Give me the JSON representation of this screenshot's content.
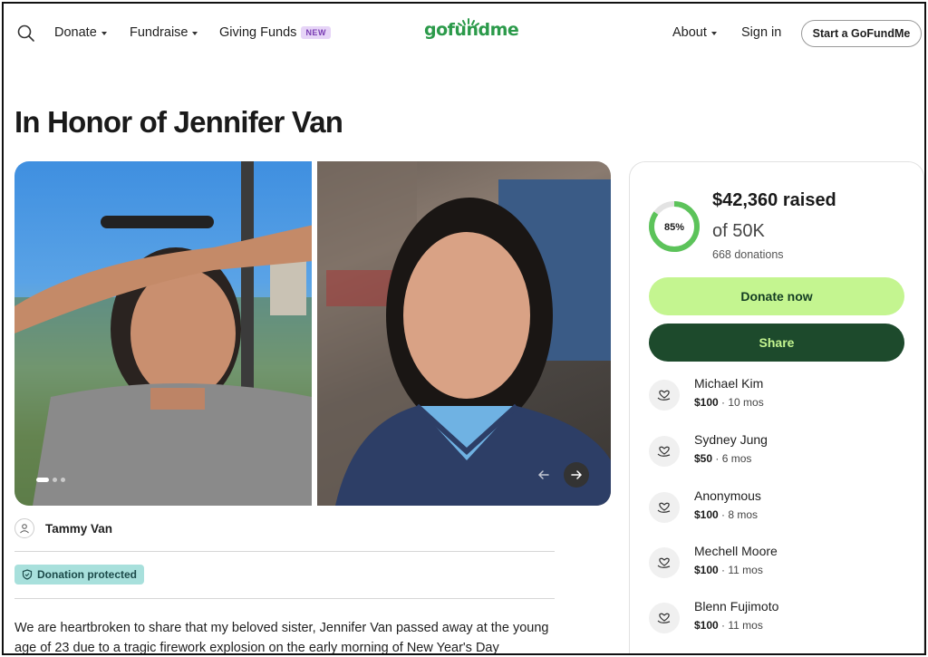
{
  "header": {
    "nav": [
      {
        "label": "Donate",
        "has_caret": true
      },
      {
        "label": "Fundraise",
        "has_caret": true
      },
      {
        "label": "Giving Funds",
        "badge": "NEW"
      }
    ],
    "logo_text": "gofundme",
    "right_nav": [
      {
        "label": "About",
        "has_caret": true
      },
      {
        "label": "Sign in"
      }
    ],
    "start_button": "Start a GoFundMe",
    "icons": {
      "search": "search-icon"
    }
  },
  "page": {
    "title": "In Honor of Jennifer Van",
    "organizer": "Tammy Van",
    "protected_label": "Donation protected",
    "story": "We are heartbroken to share that my beloved sister, Jennifer Van passed away at the young age of 23 due to a tragic firework explosion on the early morning of New Year's Day"
  },
  "gallery": {
    "photo_count": 2,
    "active_index": 0,
    "prev_icon": "arrow-left-icon",
    "next_icon": "arrow-right-icon"
  },
  "donation": {
    "percent_label": "85%",
    "percent": 0.85,
    "raised": "$42,360 raised",
    "goal": "of 50K",
    "donations_count": "668 donations",
    "donate_button": "Donate now",
    "share_button": "Share"
  },
  "donors": [
    {
      "name": "Michael Kim",
      "amount": "$100",
      "when": " · 10 mos"
    },
    {
      "name": "Sydney Jung",
      "amount": "$50",
      "when": " · 6 mos"
    },
    {
      "name": "Anonymous",
      "amount": "$100",
      "when": " · 8 mos"
    },
    {
      "name": "Mechell Moore",
      "amount": "$100",
      "when": " · 11 mos"
    },
    {
      "name": "Blenn Fujimoto",
      "amount": "$100",
      "when": " · 11 mos"
    }
  ],
  "colors": {
    "brand_green": "#2b9a4a",
    "donate_bg": "#c4f590",
    "share_bg": "#1d4a2c",
    "protected_bg": "#a8e0dc",
    "progress": "#5cc35a"
  }
}
